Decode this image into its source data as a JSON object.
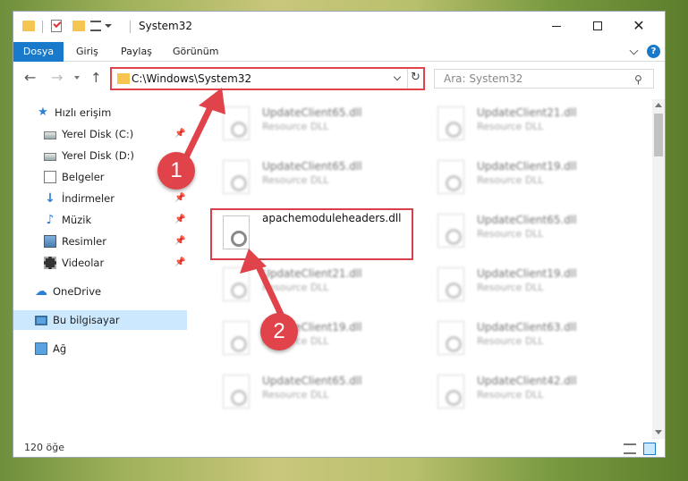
{
  "window": {
    "title": "System32",
    "tabs": [
      "Dosya",
      "Giriş",
      "Paylaş",
      "Görünüm"
    ]
  },
  "address": {
    "path": "C:\\Windows\\System32",
    "search_placeholder": "Ara: System32"
  },
  "sidebar": {
    "items": [
      {
        "label": "Hızlı erişim",
        "icon": "star-icon"
      },
      {
        "label": "Yerel Disk (C:)",
        "icon": "disk-icon",
        "pinned": true
      },
      {
        "label": "Yerel Disk (D:)",
        "icon": "disk-icon"
      },
      {
        "label": "Belgeler",
        "icon": "documents-icon"
      },
      {
        "label": "İndirmeler",
        "icon": "download-icon",
        "pinned": true
      },
      {
        "label": "Müzik",
        "icon": "music-icon",
        "pinned": true
      },
      {
        "label": "Resimler",
        "icon": "pictures-icon",
        "pinned": true
      },
      {
        "label": "Videolar",
        "icon": "videos-icon",
        "pinned": true
      },
      {
        "label": "OneDrive",
        "icon": "cloud-icon"
      },
      {
        "label": "Bu bilgisayar",
        "icon": "computer-icon",
        "selected": true
      },
      {
        "label": "Ağ",
        "icon": "network-icon"
      }
    ],
    "pin_glyph": "📌"
  },
  "files": {
    "left": [
      {
        "name": "UpdateClient65.dll",
        "desc": "Resource DLL"
      },
      {
        "name": "UpdateClient65.dll",
        "desc": "Resource DLL"
      },
      {
        "name": "apachemoduleheaders.dll",
        "desc": ""
      },
      {
        "name": "UpdateClient21.dll",
        "desc": "Resource DLL"
      },
      {
        "name": "UpdateClient19.dll",
        "desc": "Resource DLL"
      },
      {
        "name": "UpdateClient65.dll",
        "desc": "Resource DLL"
      }
    ],
    "right": [
      {
        "name": "UpdateClient21.dll",
        "desc": "Resource DLL"
      },
      {
        "name": "UpdateClient19.dll",
        "desc": "Resource DLL"
      },
      {
        "name": "UpdateClient65.dll",
        "desc": "Resource DLL"
      },
      {
        "name": "UpdateClient19.dll",
        "desc": "Resource DLL"
      },
      {
        "name": "UpdateClient63.dll",
        "desc": "Resource DLL"
      },
      {
        "name": "UpdateClient42.dll",
        "desc": "Resource DLL"
      }
    ]
  },
  "status": {
    "count": "120 öğe"
  },
  "annotations": {
    "step1": "1",
    "step2": "2",
    "color": "#e0434a"
  }
}
